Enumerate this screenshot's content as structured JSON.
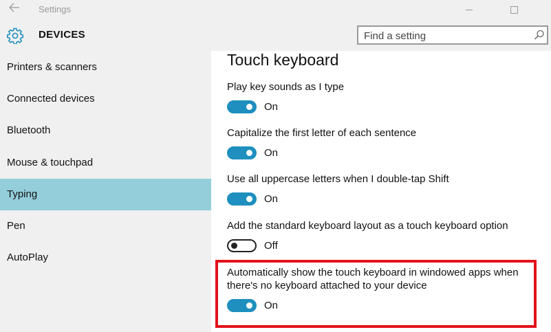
{
  "window": {
    "title": "Settings",
    "back_icon": "back-arrow-icon"
  },
  "header": {
    "section_title": "DEVICES",
    "section_icon": "gear-icon",
    "search": {
      "placeholder": "Find a setting",
      "value": ""
    }
  },
  "sidebar": {
    "items": [
      {
        "label": "Printers & scanners",
        "selected": false
      },
      {
        "label": "Connected devices",
        "selected": false
      },
      {
        "label": "Bluetooth",
        "selected": false
      },
      {
        "label": "Mouse & touchpad",
        "selected": false
      },
      {
        "label": "Typing",
        "selected": true
      },
      {
        "label": "Pen",
        "selected": false
      },
      {
        "label": "AutoPlay",
        "selected": false
      }
    ]
  },
  "main": {
    "title": "Touch keyboard",
    "settings": [
      {
        "label": "Play key sounds as I type",
        "state": "On"
      },
      {
        "label": "Capitalize the first letter of each sentence",
        "state": "On"
      },
      {
        "label": "Use all uppercase letters when I double-tap Shift",
        "state": "On"
      },
      {
        "label": "Add the standard keyboard layout as a touch keyboard option",
        "state": "Off"
      },
      {
        "label_line1": "Automatically show the touch keyboard in windowed apps when",
        "label_line2": "there's no keyboard attached to your device",
        "state": "On"
      }
    ]
  },
  "colors": {
    "accent": "#1e8fbf",
    "selection": "#93ceda",
    "highlight_border": "#e3111b"
  }
}
